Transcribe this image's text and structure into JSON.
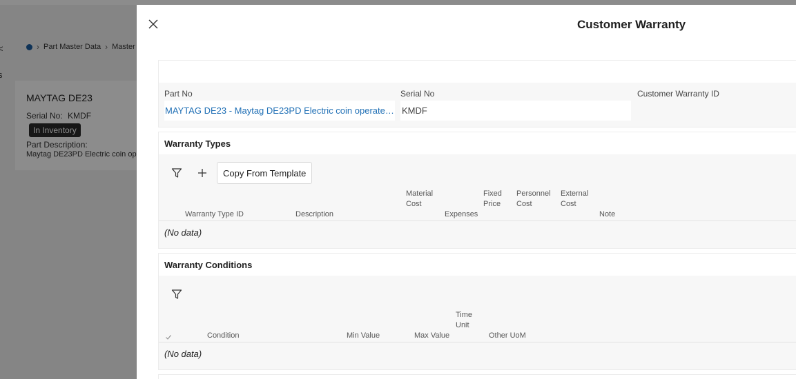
{
  "background": {
    "left_edge_texts": [
      "<",
      "s"
    ],
    "breadcrumb": [
      "Part Master Data",
      "Master"
    ],
    "card": {
      "title": "MAYTAG DE23",
      "serial_label": "Serial No:",
      "serial_value": "KMDF",
      "badge": "In Inventory",
      "part_description_label": "Part Description:",
      "part_description_value": "Maytag DE23PD Electric coin op"
    }
  },
  "dialog": {
    "title": "Customer Warranty",
    "close_icon": "close-icon",
    "header_fields": {
      "part_no_label": "Part No",
      "part_no_value": "MAYTAG DE23 - Maytag DE23PD Electric coin operated do...",
      "serial_no_label": "Serial No",
      "serial_no_value": "KMDF",
      "customer_warranty_id_label": "Customer Warranty ID"
    },
    "warranty_types": {
      "title": "Warranty Types",
      "copy_button_label": "Copy From Template",
      "columns": [
        {
          "line1": "",
          "line2": "Warranty Type ID"
        },
        {
          "line1": "",
          "line2": "Description"
        },
        {
          "line1": "Material",
          "line2": "Cost"
        },
        {
          "line1": "",
          "line2": "Expenses"
        },
        {
          "line1": "Fixed",
          "line2": "Price"
        },
        {
          "line1": "Personnel",
          "line2": "Cost"
        },
        {
          "line1": "External",
          "line2": "Cost"
        },
        {
          "line1": "",
          "line2": "Note"
        }
      ],
      "empty_text": "(No data)"
    },
    "warranty_conditions": {
      "title": "Warranty Conditions",
      "columns": [
        {
          "line1": "",
          "line2": "Condition"
        },
        {
          "line1": "",
          "line2": "Min Value"
        },
        {
          "line1": "",
          "line2": "Max Value"
        },
        {
          "line1": "Time",
          "line2": "Unit"
        },
        {
          "line1": "",
          "line2": "Other UoM"
        }
      ],
      "empty_text": "(No data)"
    }
  }
}
